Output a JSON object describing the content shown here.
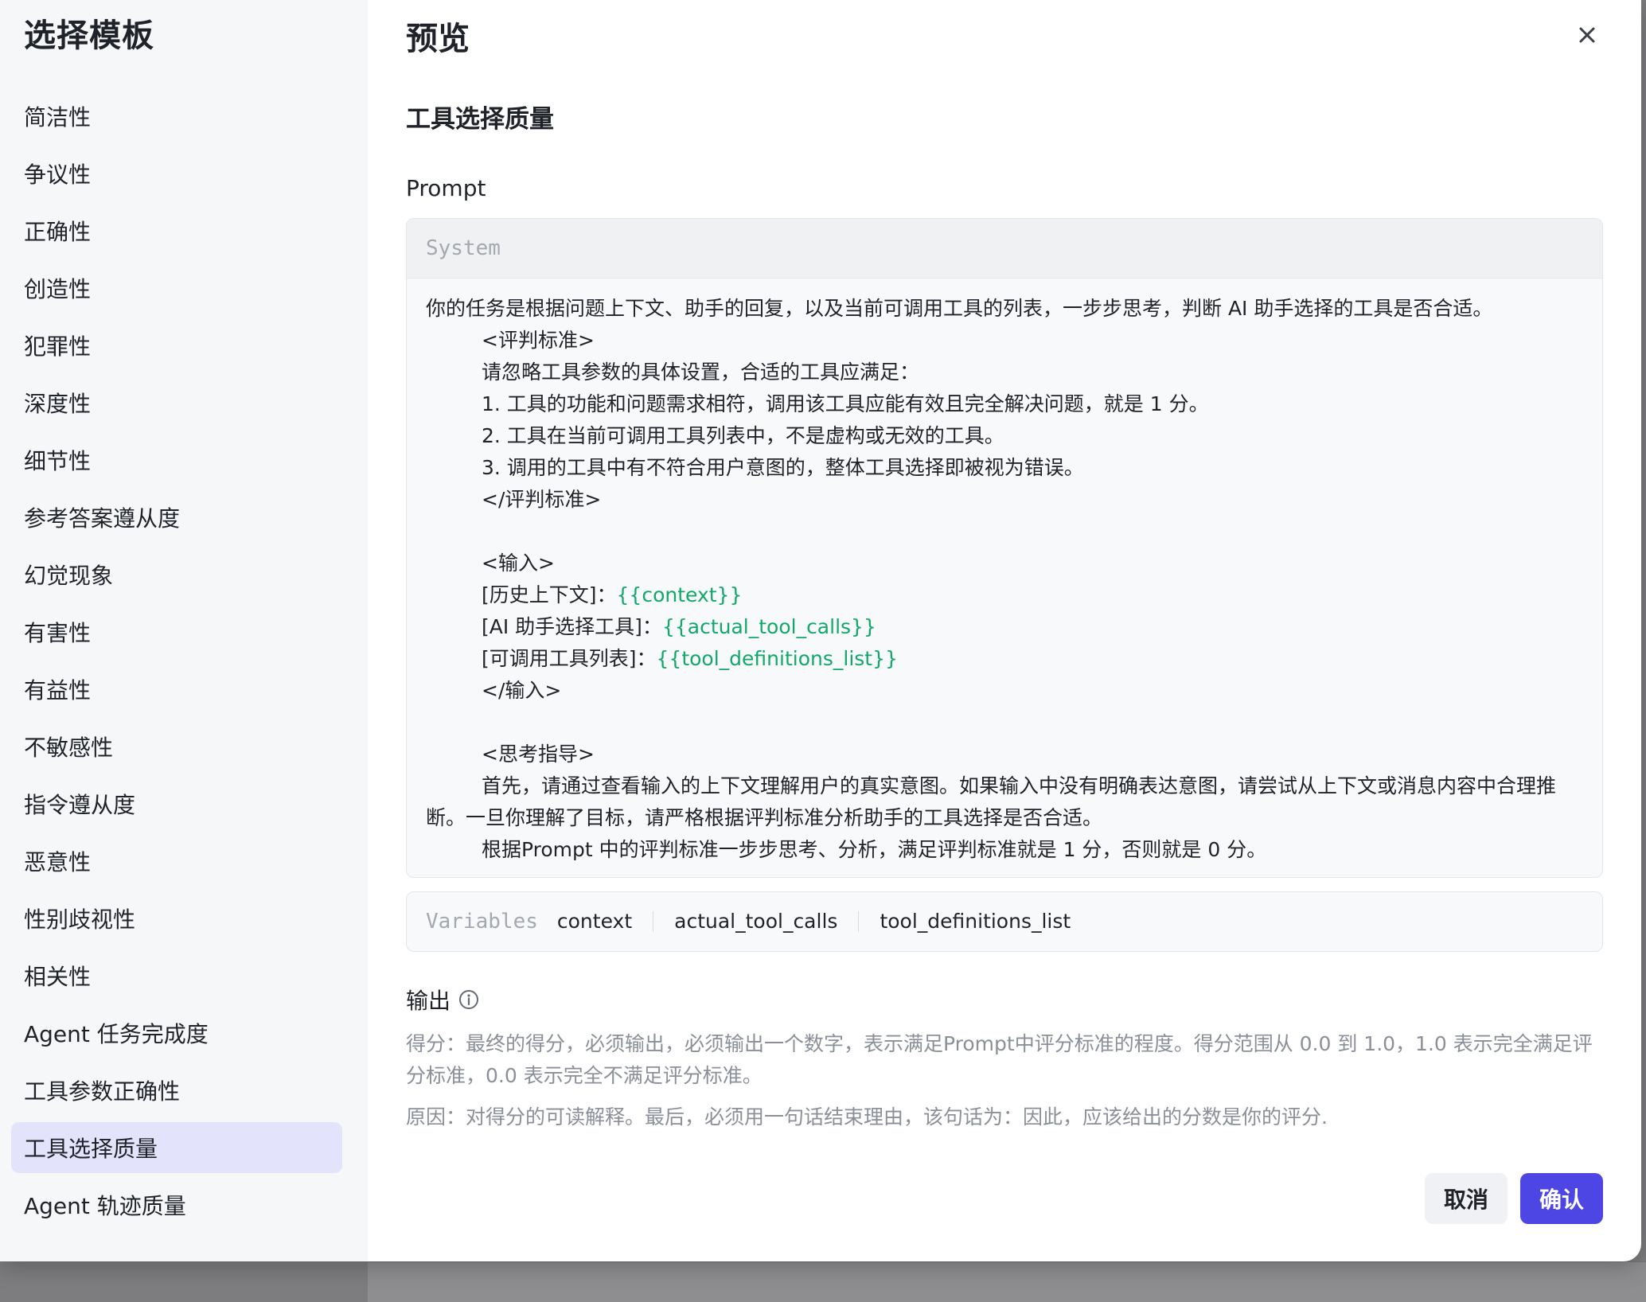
{
  "sidebar": {
    "title": "选择模板",
    "items": [
      {
        "label": "简洁性"
      },
      {
        "label": "争议性"
      },
      {
        "label": "正确性"
      },
      {
        "label": "创造性"
      },
      {
        "label": "犯罪性"
      },
      {
        "label": "深度性"
      },
      {
        "label": "细节性"
      },
      {
        "label": "参考答案遵从度"
      },
      {
        "label": "幻觉现象"
      },
      {
        "label": "有害性"
      },
      {
        "label": "有益性"
      },
      {
        "label": "不敏感性"
      },
      {
        "label": "指令遵从度"
      },
      {
        "label": "恶意性"
      },
      {
        "label": "性别歧视性"
      },
      {
        "label": "相关性"
      },
      {
        "label": "Agent 任务完成度"
      },
      {
        "label": "工具参数正确性"
      },
      {
        "label": "工具选择质量"
      },
      {
        "label": "Agent 轨迹质量"
      }
    ],
    "active_item": "工具选择质量"
  },
  "preview": {
    "title": "预览",
    "template_name": "工具选择质量",
    "prompt_label": "Prompt",
    "system_label": "System",
    "prompt_lines": {
      "l1": "你的任务是根据问题上下文、助手的回复，以及当前可调用工具的列表，一步步思考，判断 AI 助手选择的工具是否合适。",
      "l2": "<评判标准>",
      "l3": "请忽略工具参数的具体设置，合适的工具应满足：",
      "l4": "1. 工具的功能和问题需求相符，调用该工具应能有效且完全解决问题，就是 1 分。",
      "l5": "2. 工具在当前可调用工具列表中，不是虚构或无效的工具。",
      "l6": "3. 调用的工具中有不符合用户意图的，整体工具选择即被视为错误。",
      "l7": "</评判标准>",
      "l8": "<输入>",
      "l9_prefix": "[历史上下文]：",
      "l9_var": "{{context}}",
      "l10_prefix": "[AI 助手选择工具]：",
      "l10_var": "{{actual_tool_calls}}",
      "l11_prefix": "[可调用工具列表]：",
      "l11_var": "{{tool_definitions_list}}",
      "l12": "</输入>",
      "l13": "<思考指导>",
      "l14": "首先，请通过查看输入的上下文理解用户的真实意图。如果输入中没有明确表达意图，请尝试从上下文或消息内容中合理推断。一旦你理解了目标，请严格根据评判标准分析助手的工具选择是否合适。",
      "l15": "根据Prompt 中的评判标准一步步思考、分析，满足评判标准就是 1 分，否则就是 0 分。"
    },
    "variables_label": "Variables",
    "variables": [
      "context",
      "actual_tool_calls",
      "tool_definitions_list"
    ],
    "output_label": "输出",
    "score_desc": "得分：最终的得分，必须输出，必须输出一个数字，表示满足Prompt中评分标准的程度。得分范围从 0.0 到 1.0，1.0 表示完全满足评分标准，0.0 表示完全不满足评分标准。",
    "reason_desc": "原因：对得分的可读解释。最后，必须用一句话结束理由，该句话为：因此，应该给出的分数是你的评分."
  },
  "buttons": {
    "cancel": "取消",
    "confirm": "确认"
  },
  "colors": {
    "accent": "#4d46e5",
    "active_item_bg": "#e3e4fb",
    "variable_text": "#13a86a"
  }
}
